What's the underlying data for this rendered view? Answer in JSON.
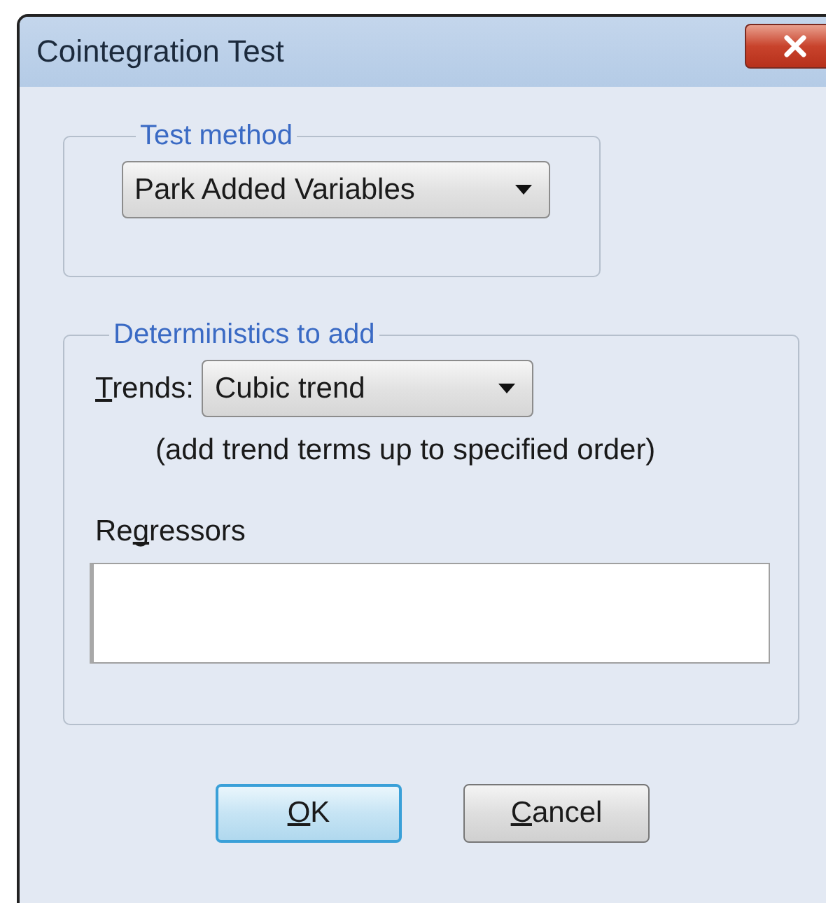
{
  "window": {
    "title": "Cointegration Test"
  },
  "test_method": {
    "legend": "Test method",
    "dropdown": {
      "value": "Park Added Variables"
    }
  },
  "deterministics": {
    "legend": "Deterministics to add",
    "trends": {
      "label": [
        {
          "text": "T",
          "underlined": true
        },
        {
          "text": "rends:",
          "underlined": false
        }
      ],
      "dropdown": {
        "value": "Cubic trend"
      }
    },
    "note": "(add trend terms up to specified order)",
    "regressors": {
      "label": [
        {
          "text": "Re",
          "underlined": false
        },
        {
          "text": "g",
          "underlined": true
        },
        {
          "text": "ressors",
          "underlined": false
        }
      ]
    }
  },
  "buttons": [
    {
      "label": [
        {
          "text": "O",
          "underlined": true
        },
        {
          "text": "K",
          "underlined": false
        }
      ],
      "default": true
    },
    {
      "label": [
        {
          "text": "C",
          "underlined": true
        },
        {
          "text": "ancel",
          "underlined": false
        }
      ],
      "default": false
    }
  ]
}
